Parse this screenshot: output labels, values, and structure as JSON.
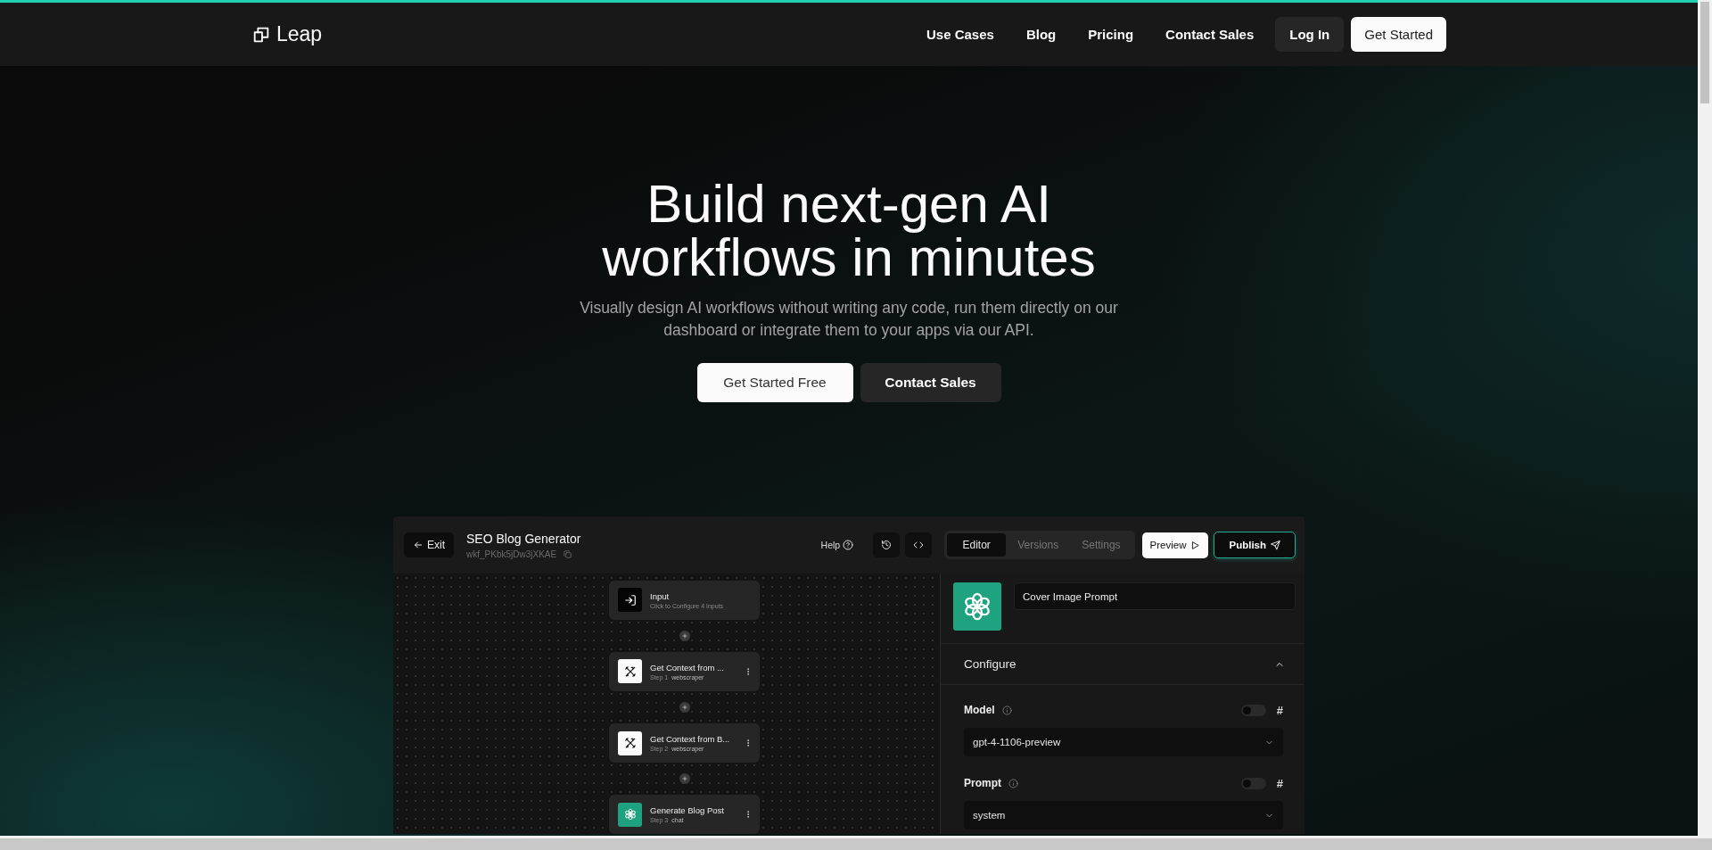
{
  "nav": {
    "logo": "Leap",
    "links": [
      "Use Cases",
      "Blog",
      "Pricing",
      "Contact Sales"
    ],
    "login": "Log In",
    "cta": "Get Started"
  },
  "hero": {
    "title": "Build next-gen AI workflows in minutes",
    "subtitle": "Visually design AI workflows without writing any code, run them directly on our dashboard or integrate them to your apps via our API.",
    "buttons": [
      {
        "label": "Get Started Free",
        "kind": "primary"
      },
      {
        "label": "Contact Sales",
        "kind": "secondary"
      }
    ]
  },
  "app": {
    "exit": "Exit",
    "title": "SEO Blog Generator",
    "workflow_id": "wkf_PKbk5jDw3jXKAE",
    "help": "Help",
    "tabs": [
      {
        "label": "Editor",
        "selected": true
      },
      {
        "label": "Versions",
        "selected": false
      },
      {
        "label": "Settings",
        "selected": false
      }
    ],
    "preview": "Preview",
    "publish": "Publish",
    "nodes": [
      {
        "kind": "input",
        "title": "Input",
        "subtitle": "Click to Configure 4 Inputs"
      },
      {
        "kind": "webscraper",
        "title": "Get Context from ...",
        "step": "Step 1",
        "type": "webscraper"
      },
      {
        "kind": "webscraper",
        "title": "Get Context from B...",
        "step": "Step 2",
        "type": "webscraper"
      },
      {
        "kind": "chat",
        "title": "Generate Blog Post",
        "step": "Step 3",
        "type": "chat"
      }
    ],
    "panel": {
      "name_value": "Cover Image Prompt",
      "section": "Configure",
      "expanded": true,
      "fields": [
        {
          "label": "Model",
          "value": "gpt-4-1106-preview",
          "on": false,
          "mark": "#"
        },
        {
          "label": "Prompt",
          "value": "system",
          "on": false,
          "mark": "#"
        }
      ]
    }
  }
}
